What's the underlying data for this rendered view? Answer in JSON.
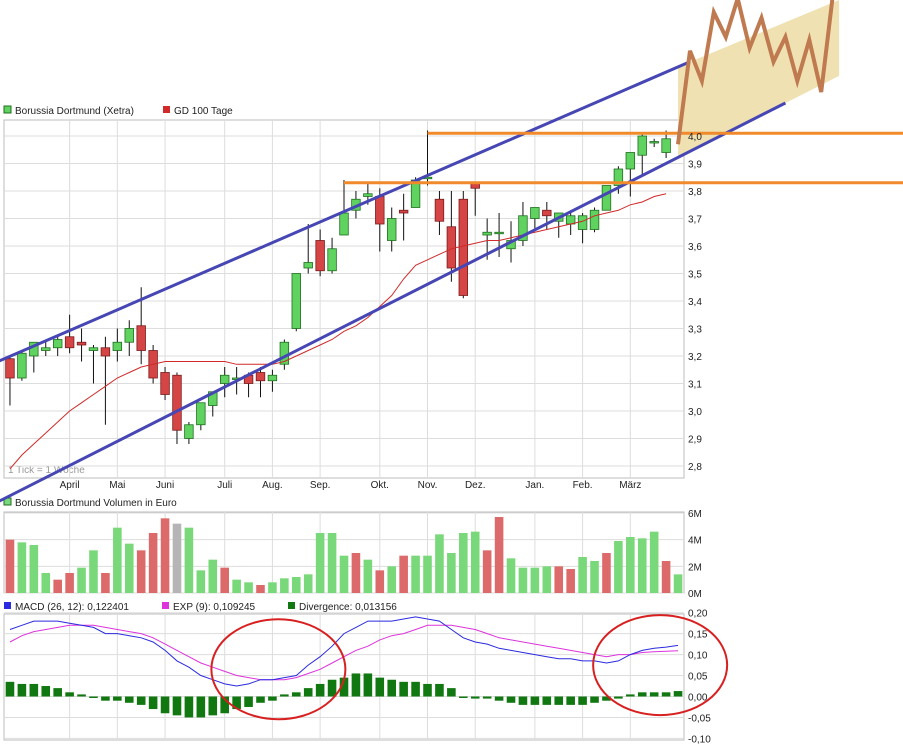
{
  "colors": {
    "bull": "#5fd25f",
    "bear": "#d64545",
    "bull_border": "#1f6f1f",
    "bear_border": "#7a1b1b",
    "sma": "#d02a2a",
    "macd": "#2a2ae0",
    "exp": "#dd33dd",
    "divergence": "#117711",
    "channel": "#4646b4",
    "horizontal": "#f08a2a",
    "forecast_zone": "#efdfae",
    "forecast_line": "#c07a50",
    "circle": "#d82020",
    "grid": "#dddddd",
    "vol_up": "#79d879",
    "vol_down": "#dd6a6a",
    "vol_gray": "#b5b5b5"
  },
  "chart_data": [
    {
      "type": "candlestick",
      "legend": [
        {
          "label": "Borussia Dortmund (Xetra)",
          "color": "#5fd25f"
        },
        {
          "label": "GD 100 Tage",
          "color": "#d02a2a"
        }
      ],
      "ylim": [
        2.7,
        4.1
      ],
      "y_ticks": [
        "4,0",
        "3,9",
        "3,8",
        "3,7",
        "3,6",
        "3,5",
        "3,4",
        "3,3",
        "3,2",
        "3,1",
        "3,0",
        "2,9",
        "2,8"
      ],
      "x_tick_labels": [
        "April",
        "Mai",
        "Juni",
        "Juli",
        "Aug.",
        "Sep.",
        "Okt.",
        "Nov.",
        "Dez.",
        "Jan.",
        "Feb.",
        "März"
      ],
      "x_tick_index": [
        5,
        9,
        13,
        18,
        22,
        26,
        31,
        35,
        39,
        44,
        48,
        52
      ],
      "note": "1 Tick = 1 Woche",
      "ohlc": [
        [
          3.19,
          3.2,
          3.02,
          3.12
        ],
        [
          3.12,
          3.22,
          3.11,
          3.21
        ],
        [
          3.2,
          3.24,
          3.14,
          3.25
        ],
        [
          3.22,
          3.26,
          3.2,
          3.23
        ],
        [
          3.23,
          3.27,
          3.2,
          3.26
        ],
        [
          3.27,
          3.35,
          3.21,
          3.23
        ],
        [
          3.25,
          3.3,
          3.18,
          3.24
        ],
        [
          3.22,
          3.24,
          3.1,
          3.23
        ],
        [
          3.23,
          3.27,
          2.95,
          3.2
        ],
        [
          3.22,
          3.3,
          3.18,
          3.25
        ],
        [
          3.25,
          3.33,
          3.2,
          3.3
        ],
        [
          3.31,
          3.45,
          3.17,
          3.22
        ],
        [
          3.22,
          3.24,
          3.1,
          3.12
        ],
        [
          3.14,
          3.16,
          3.04,
          3.06
        ],
        [
          3.13,
          3.14,
          2.88,
          2.93
        ],
        [
          2.9,
          2.96,
          2.88,
          2.95
        ],
        [
          2.95,
          3.02,
          2.93,
          3.03
        ],
        [
          3.02,
          3.07,
          2.98,
          3.07
        ],
        [
          3.1,
          3.16,
          3.05,
          3.13
        ],
        [
          3.12,
          3.16,
          3.06,
          3.12
        ],
        [
          3.13,
          3.14,
          3.05,
          3.1
        ],
        [
          3.14,
          3.16,
          3.05,
          3.11
        ],
        [
          3.11,
          3.15,
          3.07,
          3.13
        ],
        [
          3.17,
          3.26,
          3.15,
          3.25
        ],
        [
          3.3,
          3.5,
          3.29,
          3.5
        ],
        [
          3.52,
          3.68,
          3.5,
          3.54
        ],
        [
          3.62,
          3.66,
          3.49,
          3.51
        ],
        [
          3.51,
          3.63,
          3.5,
          3.59
        ],
        [
          3.64,
          3.84,
          3.64,
          3.72
        ],
        [
          3.73,
          3.8,
          3.7,
          3.77
        ],
        [
          3.78,
          3.83,
          3.75,
          3.79
        ],
        [
          3.78,
          3.81,
          3.58,
          3.68
        ],
        [
          3.62,
          3.74,
          3.58,
          3.7
        ],
        [
          3.73,
          3.79,
          3.62,
          3.72
        ],
        [
          3.74,
          3.85,
          3.74,
          3.84
        ],
        [
          3.85,
          4.02,
          3.82,
          3.85
        ],
        [
          3.77,
          3.8,
          3.64,
          3.69
        ],
        [
          3.67,
          3.8,
          3.47,
          3.52
        ],
        [
          3.77,
          3.8,
          3.41,
          3.42
        ],
        [
          3.83,
          3.83,
          3.71,
          3.81
        ],
        [
          3.64,
          3.7,
          3.55,
          3.65
        ],
        [
          3.65,
          3.72,
          3.56,
          3.65
        ],
        [
          3.59,
          3.69,
          3.54,
          3.62
        ],
        [
          3.62,
          3.76,
          3.6,
          3.71
        ],
        [
          3.7,
          3.73,
          3.66,
          3.74
        ],
        [
          3.73,
          3.76,
          3.66,
          3.71
        ],
        [
          3.69,
          3.72,
          3.63,
          3.72
        ],
        [
          3.68,
          3.73,
          3.64,
          3.71
        ],
        [
          3.66,
          3.72,
          3.61,
          3.71
        ],
        [
          3.66,
          3.74,
          3.65,
          3.73
        ],
        [
          3.73,
          3.8,
          3.73,
          3.82
        ],
        [
          3.82,
          3.89,
          3.79,
          3.88
        ],
        [
          3.88,
          3.92,
          3.78,
          3.94
        ],
        [
          3.93,
          4.01,
          3.86,
          4.0
        ],
        [
          3.98,
          3.99,
          3.96,
          3.98
        ],
        [
          3.94,
          4.02,
          3.92,
          3.99
        ]
      ],
      "sma_100": [
        2.79,
        2.84,
        2.88,
        2.92,
        2.96,
        3.0,
        3.03,
        3.06,
        3.09,
        3.12,
        3.14,
        3.16,
        3.17,
        3.18,
        3.18,
        3.18,
        3.18,
        3.18,
        3.18,
        3.17,
        3.17,
        3.17,
        3.17,
        3.18,
        3.2,
        3.22,
        3.24,
        3.26,
        3.29,
        3.31,
        3.34,
        3.38,
        3.42,
        3.48,
        3.53,
        3.55,
        3.57,
        3.59,
        3.6,
        3.61,
        3.62,
        3.62,
        3.63,
        3.64,
        3.65,
        3.66,
        3.67,
        3.68,
        3.69,
        3.71,
        3.72,
        3.73,
        3.75,
        3.76,
        3.78,
        3.79
      ],
      "channel_upper": [
        [
          -1,
          3.18
        ],
        [
          57,
          4.27
        ]
      ],
      "channel_lower": [
        [
          -1,
          2.67
        ],
        [
          65,
          4.12
        ]
      ],
      "horizontal_levels": [
        4.01,
        3.83
      ],
      "forecast_path": [
        [
          56,
          3.97
        ],
        [
          57,
          4.31
        ],
        [
          58,
          4.2
        ],
        [
          59,
          4.45
        ],
        [
          60,
          4.36
        ],
        [
          61,
          4.5
        ],
        [
          62,
          4.32
        ],
        [
          63,
          4.43
        ],
        [
          64,
          4.27
        ],
        [
          65,
          4.36
        ],
        [
          66,
          4.2
        ],
        [
          67,
          4.35
        ],
        [
          68,
          4.16
        ],
        [
          69,
          4.52
        ]
      ]
    },
    {
      "type": "bar",
      "legend": [
        {
          "label": "Borussia Dortmund Volumen in Euro",
          "color": "#79d879"
        }
      ],
      "ylim": [
        0,
        6
      ],
      "y_ticks": [
        "6M",
        "4M",
        "2M",
        "0M"
      ],
      "values": [
        4.0,
        3.8,
        3.6,
        1.5,
        1.0,
        1.5,
        1.9,
        3.2,
        1.5,
        4.9,
        3.7,
        3.2,
        4.5,
        5.6,
        5.2,
        4.9,
        1.7,
        2.5,
        1.9,
        1.0,
        0.8,
        0.6,
        0.8,
        1.1,
        1.2,
        1.4,
        4.5,
        4.5,
        2.8,
        3.0,
        2.5,
        1.7,
        2.0,
        2.8,
        2.8,
        2.8,
        4.4,
        3.0,
        4.5,
        4.6,
        3.2,
        5.7,
        2.6,
        1.9,
        1.9,
        2.0,
        2.0,
        1.8,
        2.7,
        2.4,
        3.0,
        3.9,
        4.2,
        4.1,
        4.6,
        2.4,
        1.4
      ],
      "up": [
        false,
        true,
        true,
        true,
        false,
        false,
        true,
        true,
        false,
        true,
        true,
        false,
        false,
        false,
        true,
        true,
        true,
        true,
        false,
        true,
        true,
        false,
        true,
        true,
        true,
        true,
        true,
        true,
        true,
        false,
        true,
        false,
        true,
        false,
        true,
        true,
        true,
        true,
        true,
        true,
        false,
        false,
        true,
        true,
        true,
        true,
        false,
        false,
        true,
        true,
        false,
        true,
        true,
        true,
        true,
        false,
        true
      ],
      "gray_index": [
        14
      ]
    },
    {
      "type": "line",
      "legend": [
        {
          "label": "MACD (26, 12): 0,122401",
          "color": "#2a2ae0"
        },
        {
          "label": "EXP (9): 0,109245",
          "color": "#dd33dd"
        },
        {
          "label": "Divergence: 0,013156",
          "color": "#117711"
        }
      ],
      "ylim": [
        -0.1,
        0.2
      ],
      "y_ticks": [
        "0,20",
        "0,15",
        "0,10",
        "0,05",
        "0,00",
        "-0,05",
        "-0,10"
      ],
      "macd": [
        0.16,
        0.17,
        0.18,
        0.18,
        0.18,
        0.175,
        0.17,
        0.165,
        0.15,
        0.15,
        0.145,
        0.14,
        0.13,
        0.11,
        0.085,
        0.07,
        0.05,
        0.04,
        0.03,
        0.025,
        0.03,
        0.04,
        0.04,
        0.045,
        0.05,
        0.075,
        0.095,
        0.12,
        0.15,
        0.165,
        0.18,
        0.18,
        0.18,
        0.185,
        0.19,
        0.185,
        0.18,
        0.16,
        0.14,
        0.13,
        0.125,
        0.115,
        0.11,
        0.105,
        0.1,
        0.095,
        0.09,
        0.09,
        0.085,
        0.085,
        0.08,
        0.085,
        0.1,
        0.11,
        0.115,
        0.118,
        0.122
      ],
      "exp": [
        0.13,
        0.145,
        0.155,
        0.16,
        0.165,
        0.17,
        0.17,
        0.17,
        0.165,
        0.16,
        0.155,
        0.15,
        0.14,
        0.125,
        0.11,
        0.095,
        0.08,
        0.07,
        0.06,
        0.05,
        0.045,
        0.04,
        0.04,
        0.04,
        0.045,
        0.055,
        0.065,
        0.08,
        0.095,
        0.11,
        0.12,
        0.135,
        0.145,
        0.15,
        0.16,
        0.17,
        0.17,
        0.17,
        0.165,
        0.16,
        0.15,
        0.14,
        0.135,
        0.13,
        0.125,
        0.12,
        0.115,
        0.11,
        0.105,
        0.1,
        0.095,
        0.1,
        0.1,
        0.105,
        0.107,
        0.108,
        0.109
      ],
      "divergence": [
        0.035,
        0.03,
        0.03,
        0.025,
        0.02,
        0.01,
        0.005,
        0.0,
        -0.01,
        -0.01,
        -0.015,
        -0.02,
        -0.03,
        -0.04,
        -0.045,
        -0.05,
        -0.05,
        -0.045,
        -0.04,
        -0.03,
        -0.025,
        -0.015,
        -0.01,
        0.005,
        0.01,
        0.02,
        0.03,
        0.04,
        0.045,
        0.055,
        0.055,
        0.045,
        0.04,
        0.035,
        0.035,
        0.03,
        0.03,
        0.02,
        0.0,
        -0.005,
        -0.005,
        -0.01,
        -0.015,
        -0.02,
        -0.02,
        -0.02,
        -0.02,
        -0.02,
        -0.02,
        -0.015,
        -0.01,
        -0.005,
        0.005,
        0.01,
        0.01,
        0.01,
        0.013
      ],
      "highlight_circles": [
        [
          22.5,
          0.065
        ],
        [
          54.5,
          0.075
        ]
      ]
    }
  ]
}
